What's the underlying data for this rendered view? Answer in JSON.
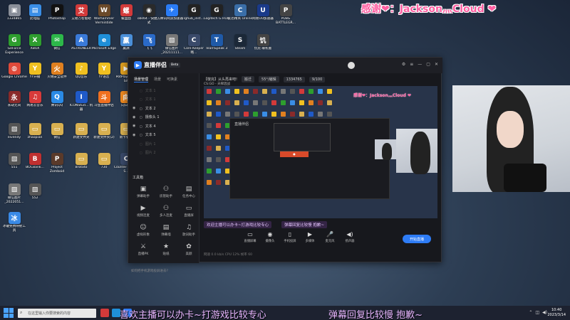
{
  "overlay": {
    "thanks": "感谢❤：Jackson灬Cloud ❤"
  },
  "desktop_icons": [
    {
      "label": "1334865",
      "color": "#8a8f99",
      "glyph": "▣"
    },
    {
      "label": "此电脑",
      "color": "#3a8ee6",
      "glyph": "▤"
    },
    {
      "label": "Photoshop",
      "color": "#111",
      "glyph": "P"
    },
    {
      "label": "艾德万智能助",
      "color": "#d23a3a",
      "glyph": "艾"
    },
    {
      "label": "Warhammer Vermintide",
      "color": "#6b4a2a",
      "glyph": "W"
    },
    {
      "label": "螺盒面",
      "color": "#d23a3a",
      "glyph": "螺"
    },
    {
      "label": "obs64 - 快捷方式",
      "color": "#2a2a2a",
      "glyph": "◉"
    },
    {
      "label": "腾讯网游加速器",
      "color": "#2a7cf6",
      "glyph": "✈"
    },
    {
      "label": "lghub_inst...",
      "color": "#222",
      "glyph": "G"
    },
    {
      "label": "Logitech G HUB",
      "color": "#222",
      "glyph": "G"
    },
    {
      "label": "反恐精英 Online",
      "color": "#3a6ea8",
      "glyph": "C"
    },
    {
      "label": "网易UU加速器",
      "color": "#1a3a8a",
      "glyph": "U"
    },
    {
      "label": "PUBG BATTLEGR...",
      "color": "#444",
      "glyph": "P"
    },
    {
      "label": "GeForce Experience",
      "color": "#2e9e2e",
      "glyph": "G"
    },
    {
      "label": "XBOX",
      "color": "#2e9e2e",
      "glyph": "X"
    },
    {
      "label": "微信",
      "color": "#2db84a",
      "glyph": "✉"
    },
    {
      "label": "ASTRONEER",
      "color": "#3a7ad8",
      "glyph": "A"
    },
    {
      "label": "Microsoft Edge",
      "color": "#1f8fd8",
      "glyph": "e"
    },
    {
      "label": "赢洲",
      "color": "#4a8fd8",
      "glyph": "赢"
    },
    {
      "label": "飞飞",
      "color": "#2a6ac8",
      "glyph": "飞"
    },
    {
      "label": "微信图片_20211111...",
      "color": "#777",
      "glyph": "▧"
    },
    {
      "label": "Core Keeper 略...",
      "color": "#3a4a6a",
      "glyph": "C"
    },
    {
      "label": "TeamSpeak 3",
      "color": "#1f5aa8",
      "glyph": "T"
    },
    {
      "label": "Steam",
      "color": "#1b2838",
      "glyph": "S"
    },
    {
      "label": "饥荒:联机版",
      "color": "#444",
      "glyph": "饥"
    },
    {
      "label": "Google Chrome",
      "color": "#e04a3a",
      "glyph": "◍"
    },
    {
      "label": "YY开播",
      "color": "#f0c020",
      "glyph": "Y"
    },
    {
      "label": "火绒安全软件",
      "color": "#e08020",
      "glyph": "火"
    },
    {
      "label": "QQ音乐",
      "color": "#f0c020",
      "glyph": "♪"
    },
    {
      "label": "YY语音",
      "color": "#f0c020",
      "glyph": "Y"
    },
    {
      "label": "PotPlayer 64 bit",
      "color": "#e0a020",
      "glyph": "▶"
    },
    {
      "label": "永劫无间",
      "color": "#8a2a2a",
      "glyph": "永"
    },
    {
      "label": "网易云音乐",
      "color": "#d83a3a",
      "glyph": "♫"
    },
    {
      "label": "腾讯QQ",
      "color": "#2a8ae6",
      "glyph": "Q"
    },
    {
      "label": "ICONStud... 机器",
      "color": "#1f5ac8",
      "glyph": "I"
    },
    {
      "label": "斗鱼直播伴侣",
      "color": "#f07020",
      "glyph": "斗"
    },
    {
      "label": "向日葵",
      "color": "#f08a20",
      "glyph": "向"
    },
    {
      "label": "eivendy",
      "color": "#555",
      "glyph": "▧"
    },
    {
      "label": "zhaopian",
      "color": "#d8b050",
      "glyph": "▭"
    },
    {
      "label": "微信",
      "color": "#d8b050",
      "glyph": "▭"
    },
    {
      "label": "新建文件夹",
      "color": "#d8b050",
      "glyph": "▭"
    },
    {
      "label": "新建文件夹(2)",
      "color": "#d8b050",
      "glyph": "▭"
    },
    {
      "label": "新卡餐厅",
      "color": "#d8b050",
      "glyph": "▭"
    },
    {
      "label": "551",
      "color": "#555",
      "glyph": "▧"
    },
    {
      "label": "BOCBank...",
      "color": "#c03030",
      "glyph": "B"
    },
    {
      "label": "Project Zomboid",
      "color": "#5a3a2a",
      "glyph": "P"
    },
    {
      "label": "Brotato",
      "color": "#d8b050",
      "glyph": "▭"
    },
    {
      "label": "730",
      "color": "#d8b050",
      "glyph": "▭"
    },
    {
      "label": "Counter Global S...",
      "color": "#3a4a6a",
      "glyph": "C"
    },
    {
      "label": "微信图片_2022051...",
      "color": "#777",
      "glyph": "▧"
    },
    {
      "label": "552",
      "color": "#555",
      "glyph": "▧"
    },
    {
      "label": "冰破免费映射工具",
      "color": "#3a8ae6",
      "glyph": "冰"
    }
  ],
  "app": {
    "title": "直播伴侣",
    "beta": "Beta",
    "sidebar_tabs": [
      "场景管理",
      "场景",
      "可换素"
    ],
    "scenes": [
      {
        "label": "文本 1",
        "dim": true
      },
      {
        "label": "文本 1",
        "dim": true
      },
      {
        "label": "文本 2",
        "dim": false
      },
      {
        "label": "摄像头 1",
        "dim": false
      },
      {
        "label": "文本 4",
        "dim": false
      },
      {
        "label": "文本 5",
        "dim": false
      },
      {
        "label": "图片 1",
        "dim": true
      },
      {
        "label": "图片 2",
        "dim": true
      }
    ],
    "tools_title": "工具箱",
    "tools": [
      "弹幕助手",
      "房管助手",
      "任务中心",
      "视频连麦",
      "多人连麦",
      "直播屏",
      "虚拟形象",
      "弹幕墙",
      "歌词助手",
      "直播PK",
      "贴纸",
      "美颜"
    ],
    "footer": "如何把手机游戏投屏进去?",
    "title_row": [
      "【敬完】从头再来吧!",
      "搬迁",
      "55°/编辑",
      "1334765",
      "9/100"
    ],
    "category": "CS:GO - 天梯混战",
    "danmaku": [
      "欢迎主播可以办卡~打游戏比较专心",
      "弹幕回复比较慢 抱歉~"
    ],
    "controls": [
      "直播屏幕",
      "摄像头",
      "手机投屏",
      "多媒体",
      "麦克风",
      "扬声器"
    ],
    "start_label": "开始直播",
    "status": "网速 0.0 kb/s   CPU 12%   帧率 60"
  },
  "taskbar": {
    "search_placeholder": "在这里输入你要搜索的内容",
    "ticker": "喜欢主播可以办卡~打游戏比较专心",
    "ticker2": "弹幕回复比较慢 抱歉~",
    "time": "10:40",
    "date": "2023/3/14"
  },
  "colors": {
    "accent": "#2e7cf6",
    "thanks": "#ff5fa2",
    "ticker": "#e7b6ff"
  }
}
